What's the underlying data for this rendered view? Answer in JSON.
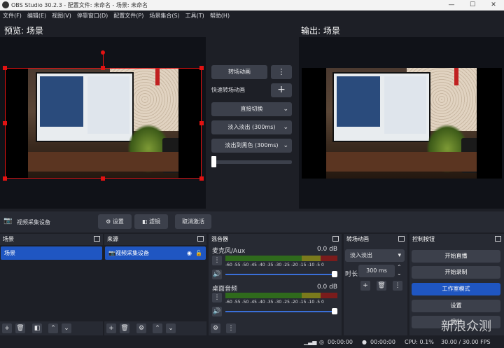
{
  "window": {
    "title": "OBS Studio 30.2.3 - 配置文件: 未命名 - 场景: 未命名",
    "minimize": "—",
    "maximize": "☐",
    "close": "✕"
  },
  "menu": [
    "文件(F)",
    "编辑(E)",
    "视图(V)",
    "停靠窗口(D)",
    "配置文件(P)",
    "场景集合(S)",
    "工具(T)",
    "帮助(H)"
  ],
  "preview": {
    "title": "预览: 场景"
  },
  "program": {
    "title": "输出: 场景"
  },
  "transition": {
    "button": "转场动画",
    "quick_label": "快速转场动画",
    "add": "+",
    "more": "⋮",
    "options": [
      "直接切换",
      "淡入淡出 (300ms)",
      "淡出到黑色 (300ms)"
    ]
  },
  "source_bar": {
    "source_name": "视频采集设备",
    "settings": "设置",
    "filters": "滤镜",
    "deactivate": "取消激活"
  },
  "docks": {
    "scenes": {
      "title": "场景",
      "items": [
        "场景"
      ]
    },
    "sources": {
      "title": "来源",
      "items": [
        "视频采集设备"
      ]
    },
    "mixer": {
      "title": "混音器",
      "channels": [
        {
          "name": "麦克风/Aux",
          "db": "0.0 dB"
        },
        {
          "name": "桌面音频",
          "db": "0.0 dB"
        }
      ],
      "scale": [
        "-60",
        "-55",
        "-50",
        "-45",
        "-40",
        "-35",
        "-30",
        "-25",
        "-20",
        "-15",
        "-10",
        "-5",
        "0"
      ]
    },
    "transitions": {
      "title": "转场动画",
      "selected": "淡入淡出",
      "duration_label": "时长",
      "duration": "300 ms"
    },
    "controls": {
      "title": "控制按钮",
      "buttons": [
        "开始直播",
        "开始录制",
        "工作室模式",
        "设置",
        "退出"
      ]
    }
  },
  "status": {
    "rec_time": "00:00:00",
    "stream_time": "00:00:00",
    "cpu": "CPU: 0.1%",
    "fps": "30.00 / 30.00 FPS"
  },
  "watermark": "新浪众测",
  "colors": {
    "accent": "#1f56c2",
    "selection": "#e21212",
    "bg": "#1d1f26",
    "panel": "#272a33",
    "button": "#3c404b"
  }
}
